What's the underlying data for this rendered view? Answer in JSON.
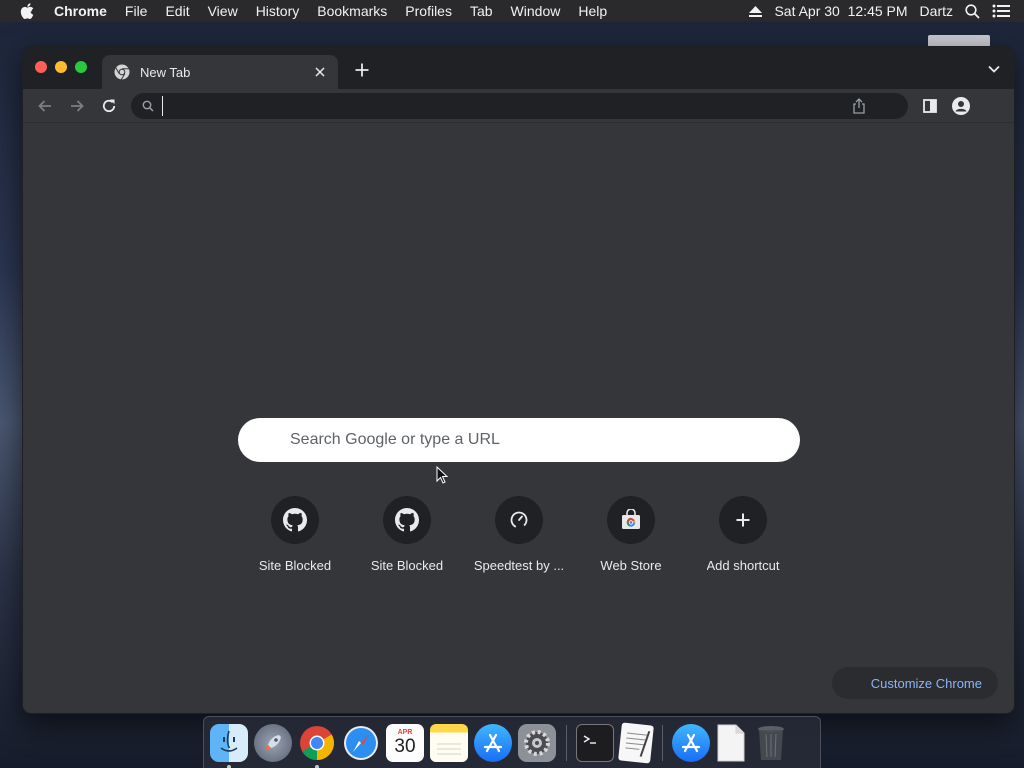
{
  "menubar": {
    "app_name": "Chrome",
    "items": [
      "File",
      "Edit",
      "View",
      "History",
      "Bookmarks",
      "Profiles",
      "Tab",
      "Window",
      "Help"
    ],
    "datetime": "Sat Apr 30  12:45 PM",
    "user": "Dartz"
  },
  "browser": {
    "tab_title": "New Tab",
    "omnibox_value": ""
  },
  "ntp": {
    "search_placeholder": "Search Google or type a URL",
    "shortcuts": [
      {
        "label": "Site Blocked",
        "icon": "github-icon"
      },
      {
        "label": "Site Blocked",
        "icon": "github-icon"
      },
      {
        "label": "Speedtest by ...",
        "icon": "speedometer-icon"
      },
      {
        "label": "Web Store",
        "icon": "web-store-icon"
      },
      {
        "label": "Add shortcut",
        "icon": "plus-icon"
      }
    ],
    "customize_label": "Customize Chrome"
  },
  "dock": {
    "calendar_month": "APR",
    "calendar_day": "30",
    "apps": [
      "finder-icon",
      "launchpad-icon",
      "chrome-icon",
      "safari-icon",
      "calendar-icon",
      "notes-icon",
      "app-store-icon",
      "system-preferences-icon",
      "terminal-icon",
      "textedit-icon",
      "app-store-downloads-icon",
      "document-icon",
      "trash-icon"
    ]
  },
  "colors": {
    "window_bg": "#35363a",
    "tabstrip_bg": "#202124",
    "link_blue": "#8ab4f8"
  }
}
